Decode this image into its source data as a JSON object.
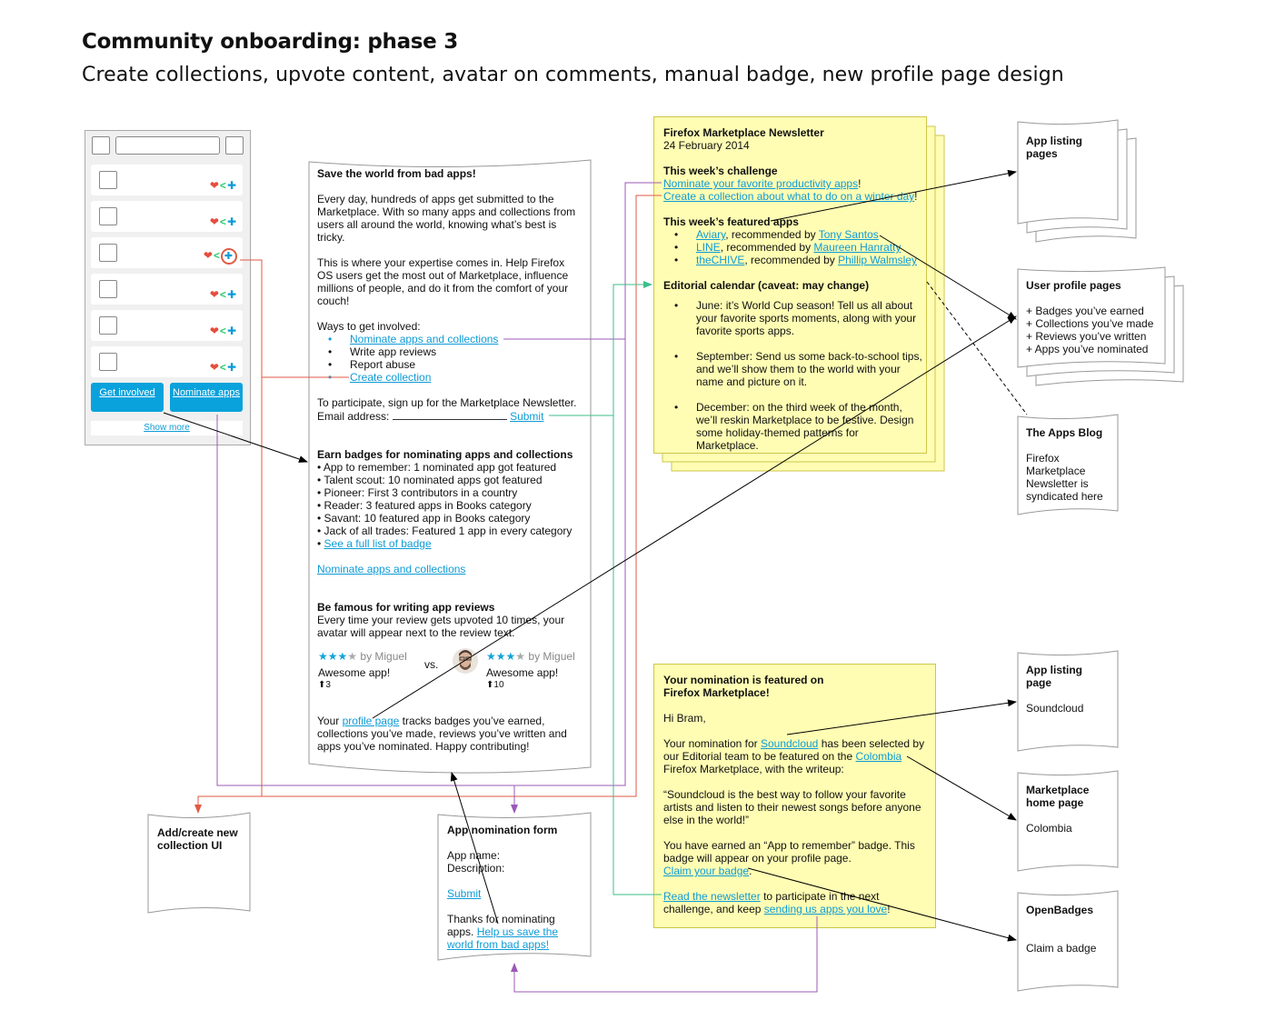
{
  "title": "Community onboarding: phase 3",
  "subtitle": "Create collections, upvote content, avatar on comments, manual badge, new profile page design",
  "phone": {
    "get_involved": "Get involved",
    "nominate_apps": "Nominate apps",
    "show_more": "Show more"
  },
  "landing": {
    "heading": "Save the world from bad apps!",
    "p1": "Every day, hundreds of apps get submitted to the Marketplace. With so many apps and collections from users all around the world, knowing what’s best is tricky.",
    "p2": "This is where your expertise comes in. Help Firefox OS users get the most out of Marketplace, influence millions of people, and do it from the comfort of your couch!",
    "ways": "Ways to get involved:",
    "ways_items": [
      "Nominate apps and collections",
      "Write app reviews",
      "Report abuse",
      "Create collection"
    ],
    "participate": "To participate, sign up for the Marketplace Newsletter.",
    "email_label": "Email address:",
    "submit": "Submit",
    "badges_heading": "Earn badges for nominating apps and collections",
    "badges": [
      "App to remember: 1 nominated app got featured",
      "Talent scout: 10 nominated apps got featured",
      "Pioneer: First 3 contributors in a country",
      "Reader: 3 featured apps in Books category",
      "Savant: 10 featured app in Books category",
      "Jack of all trades: Featured 1 app in every category"
    ],
    "badges_link": "See a full list of badge",
    "nominate_link": "Nominate apps and collections",
    "famous_heading": "Be famous for writing app reviews",
    "famous_text": "Every time your review gets upvoted 10 times, your avatar will appear next to the review text.",
    "review_by": "by Miguel",
    "review_text": "Awesome app!",
    "votes_left": "3",
    "votes_right": "10",
    "vs": "vs.",
    "profile_pre": "Your ",
    "profile_link": "profile page",
    "profile_post": " tracks badges you’ve earned, collections you’ve made, reviews you’ve written and apps you’ve nominated. Happy contributing!"
  },
  "newsletter": {
    "title": "Firefox Marketplace Newsletter",
    "date": "24 February 2014",
    "challenge_heading": "This week’s challenge",
    "challenge1": "Nominate your favorite productivity apps",
    "challenge2": "Create a collection about what to do on a winter day",
    "featured_heading": "This week’s featured apps",
    "featured": [
      {
        "app": "Aviary",
        "by": "Tony Santos"
      },
      {
        "app": "LINE",
        "by": "Maureen Hanratty"
      },
      {
        "app": "theCHIVE",
        "by": "Phillip Walmsley"
      }
    ],
    "recommended_by": ", recommended by ",
    "calendar_heading": "Editorial calendar (caveat: may change)",
    "calendar": [
      "June: it’s World Cup season! Tell us all about your favorite sports moments, along with your favorite sports apps.",
      "September: Send us some back-to-school tips, and we’ll show them to the world with your name and picture on it.",
      "December: on the third week of the month, we’ll reskin Marketplace to be festive. Design some holiday-themed patterns for Marketplace."
    ]
  },
  "email": {
    "heading": "Your nomination is featured on Firefox Marketplace!",
    "greeting": "Hi Bram,",
    "p1_a": "Your nomination for ",
    "p1_link1": "Soundcloud",
    "p1_b": " has been selected by our Editorial team to be featured on the ",
    "p1_link2": "Colombia",
    "p1_c": " Firefox Marketplace, with the writeup:",
    "quote": "“Soundcloud is the best way to follow your favorite artists and listen to their newest songs before anyone else in the world!”",
    "p2": "You have earned an “App to remember” badge. This badge will appear on your profile page.",
    "claim": "Claim your badge",
    "read_link": "Read the newsletter",
    "p3_mid": " to participate in the next challenge, and keep ",
    "p3_link": "sending us apps you love"
  },
  "form": {
    "heading": "App nomination form",
    "app_name": "App name:",
    "description": "Description:",
    "submit": "Submit",
    "thanks": "Thanks for nominating apps. ",
    "help_link": "Help us save the world from bad apps!"
  },
  "collection_ui": {
    "heading": "Add/create new collection UI"
  },
  "right_docs": {
    "app_listing_pages": "App listing pages",
    "user_profile_heading": "User profile pages",
    "user_profile_items": [
      "+ Badges you’ve earned",
      "+ Collections you’ve made",
      "+ Reviews you’ve written",
      "+ Apps you’ve nominated"
    ],
    "apps_blog_heading": "The Apps Blog",
    "apps_blog_text": "Firefox Marketplace Newsletter is syndicated here",
    "app_listing_page": "App listing page",
    "app_listing_page_value": "Soundcloud",
    "marketplace_home": "Marketplace home page",
    "marketplace_home_value": "Colombia",
    "openbadges": "OpenBadges",
    "openbadges_value": "Claim a badge"
  },
  "colors": {
    "link": "#0e9bd6",
    "sticky": "#fffdb3",
    "wire_red": "#e05a44",
    "wire_purple": "#9b59b6",
    "wire_green": "#3bbf8a",
    "button": "#0aa2dc"
  }
}
